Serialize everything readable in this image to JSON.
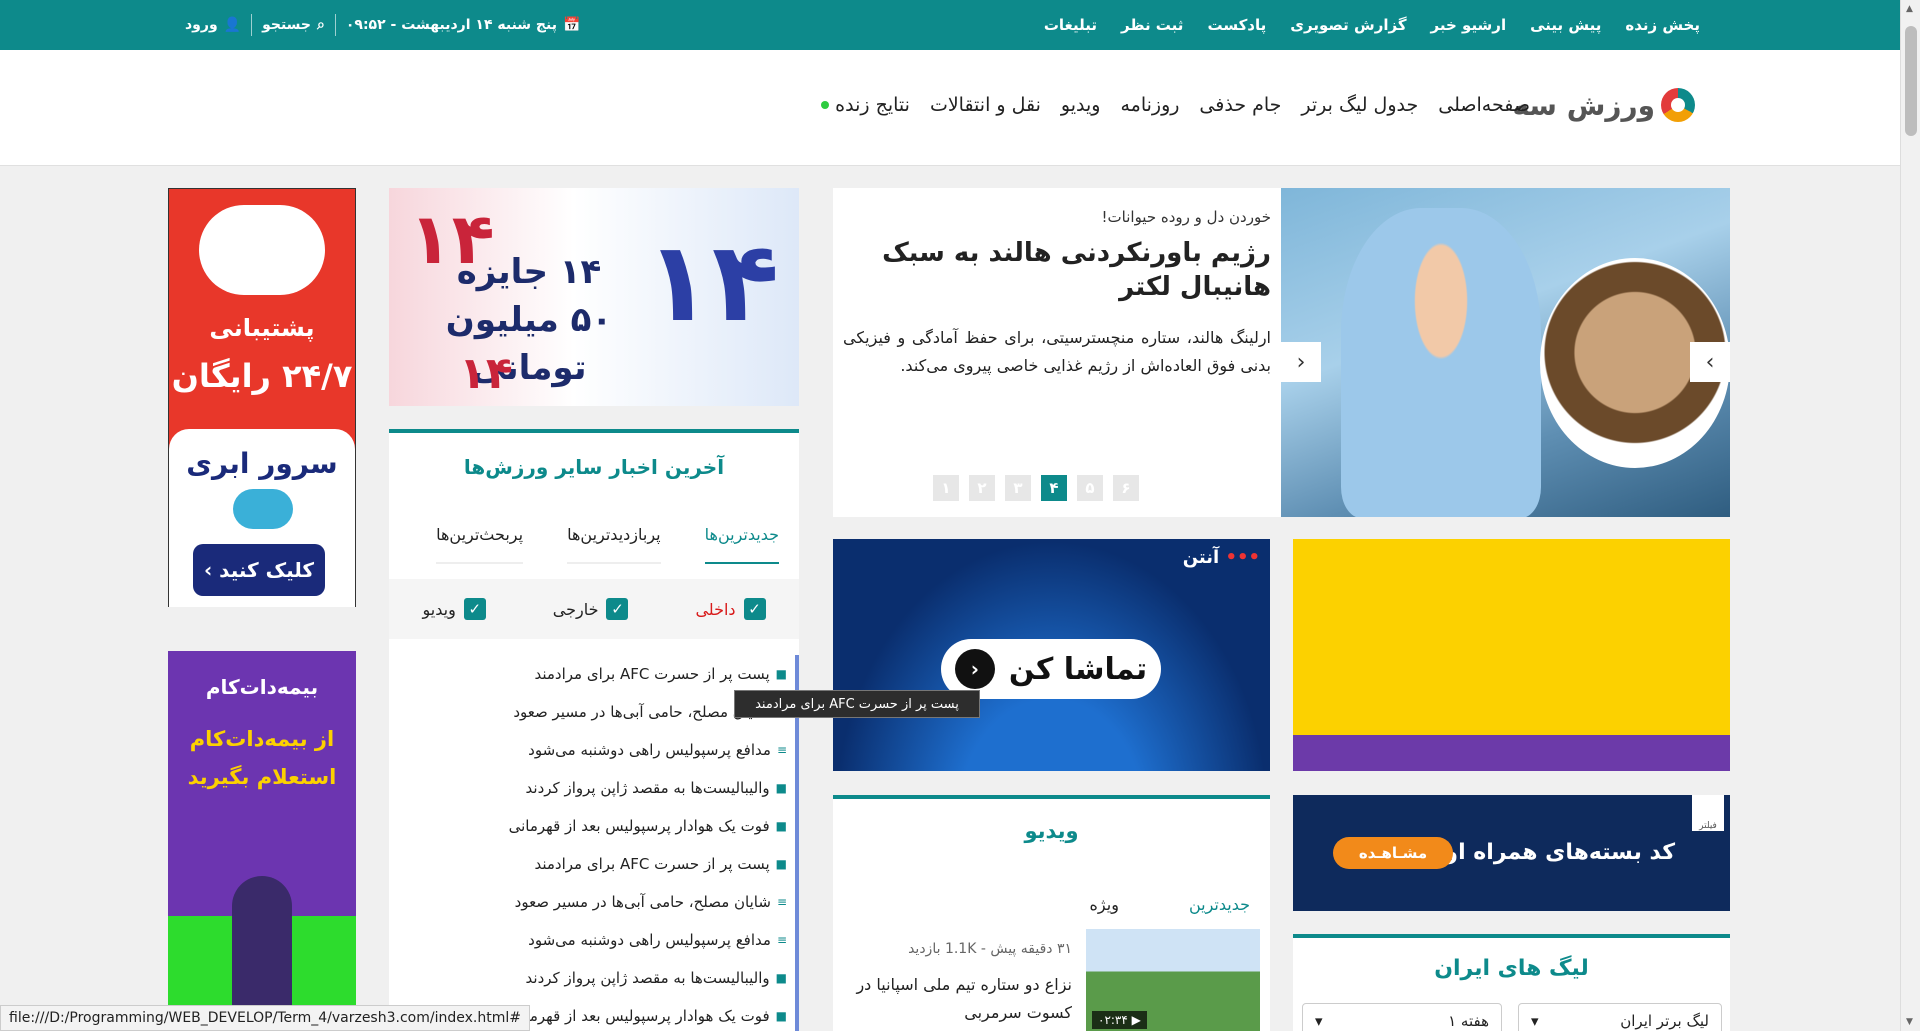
{
  "topbar": {
    "links": [
      "پخش زنده",
      "پیش بینی",
      "ارشیو خبر",
      "گزارش تصویری",
      "پادکست",
      "ثبت نظر",
      "تبلیغات"
    ],
    "date": "پنج شنبه ۱۴ اردیبهشت - ۰۹:۵۲",
    "search_label": "جستجو",
    "login_label": "ورود"
  },
  "nav": {
    "logo_text": "ورزش سه",
    "menu": [
      "صفحه‌اصلی",
      "جدول لیگ برتر",
      "جام حذفی",
      "روزنامه",
      "ویدیو",
      "نقل و انتقالات"
    ],
    "live_label": "نتایج زنده"
  },
  "hero": {
    "kicker": "خوردن دل و روده حیوانات!",
    "title": "رژیم باورنکردنی هالند به سبک هانیبال لکتر",
    "summary": "ارلینگ هالند، ستاره منچسترسیتی، برای حفظ آمادگی و فیزیکی بدنی فوق العاده‌اش از رژیم غذایی خاصی پیروی می‌کند.",
    "pages": [
      "۶",
      "۵",
      "۴",
      "۳",
      "۲",
      "۱"
    ],
    "active_page": "۴"
  },
  "ads": {
    "prize": {
      "line1": "۱۴ جایزه",
      "line2": "۵۰ میلیون تومانی",
      "num": "۱۴"
    },
    "cloud": {
      "line1": "پشتیبانی",
      "line2": "۲۴/۷ رایگان",
      "line3": "سرور ابری",
      "button": "کلیک کنید ›"
    },
    "bime": {
      "logo": "بیمه‌دات‌کام",
      "line1": "از بیمه‌دات‌کام",
      "line2": "استعلام بگیرید"
    },
    "watch": {
      "brand": "آنتن",
      "button": "تماشا کن"
    },
    "mci": {
      "text": "کد بسته‌های همراه اول",
      "button": "مشـاهـده",
      "tag": "فیلتر"
    }
  },
  "news": {
    "title": "آخرین اخبار سایر ورزش‌ها",
    "tabs": [
      "جدیدترین‌ها",
      "پربازدیدترین‌ها",
      "پربحث‌ترین‌ها"
    ],
    "filters": [
      "داخلی",
      "خارجی",
      "ویدیو"
    ],
    "items": [
      "پست پر از حسرت AFC برای مرادمند",
      "شایان مصلح، حامی آبی‌ها در مسیر صعود",
      "مدافع پرسپولیس راهی دوشنبه می‌شود",
      "والیبالیست‌ها به مقصد ژاپن پرواز کردند",
      "فوت یک هوادار پرسپولیس بعد از قهرمانی",
      "پست پر از حسرت AFC برای مرادمند",
      "شایان مصلح، حامی آبی‌ها در مسیر صعود",
      "مدافع پرسپولیس راهی دوشنبه می‌شود",
      "والیبالیست‌ها به مقصد ژاپن پرواز کردند",
      "فوت یک هوادار پرسپولیس بعد از قهرمانی"
    ],
    "tooltip": "پست پر از حسرت AFC برای مرادمند"
  },
  "video": {
    "title": "ویدیو",
    "tabs": [
      "جدیدترین",
      "ویژه"
    ],
    "item_meta": "۳۱ دقیقه پیش - 1.1K بازدید",
    "item_title": "نزاع دو ستاره تیم ملی اسپانیا در کسوت سرمربی",
    "duration": "۰۲:۳۴"
  },
  "league": {
    "title": "لیگ های ایران",
    "select1": "لیگ برتر ایران",
    "select2": "هفته ۱"
  },
  "statusbar": "file:///D:/Programming/WEB_DEVELOP/Term_4/varzesh3.com/index.html#",
  "colors": {
    "brand": "#0d8a8b",
    "live": "#2ecc40",
    "active_red": "#d81b1b"
  }
}
